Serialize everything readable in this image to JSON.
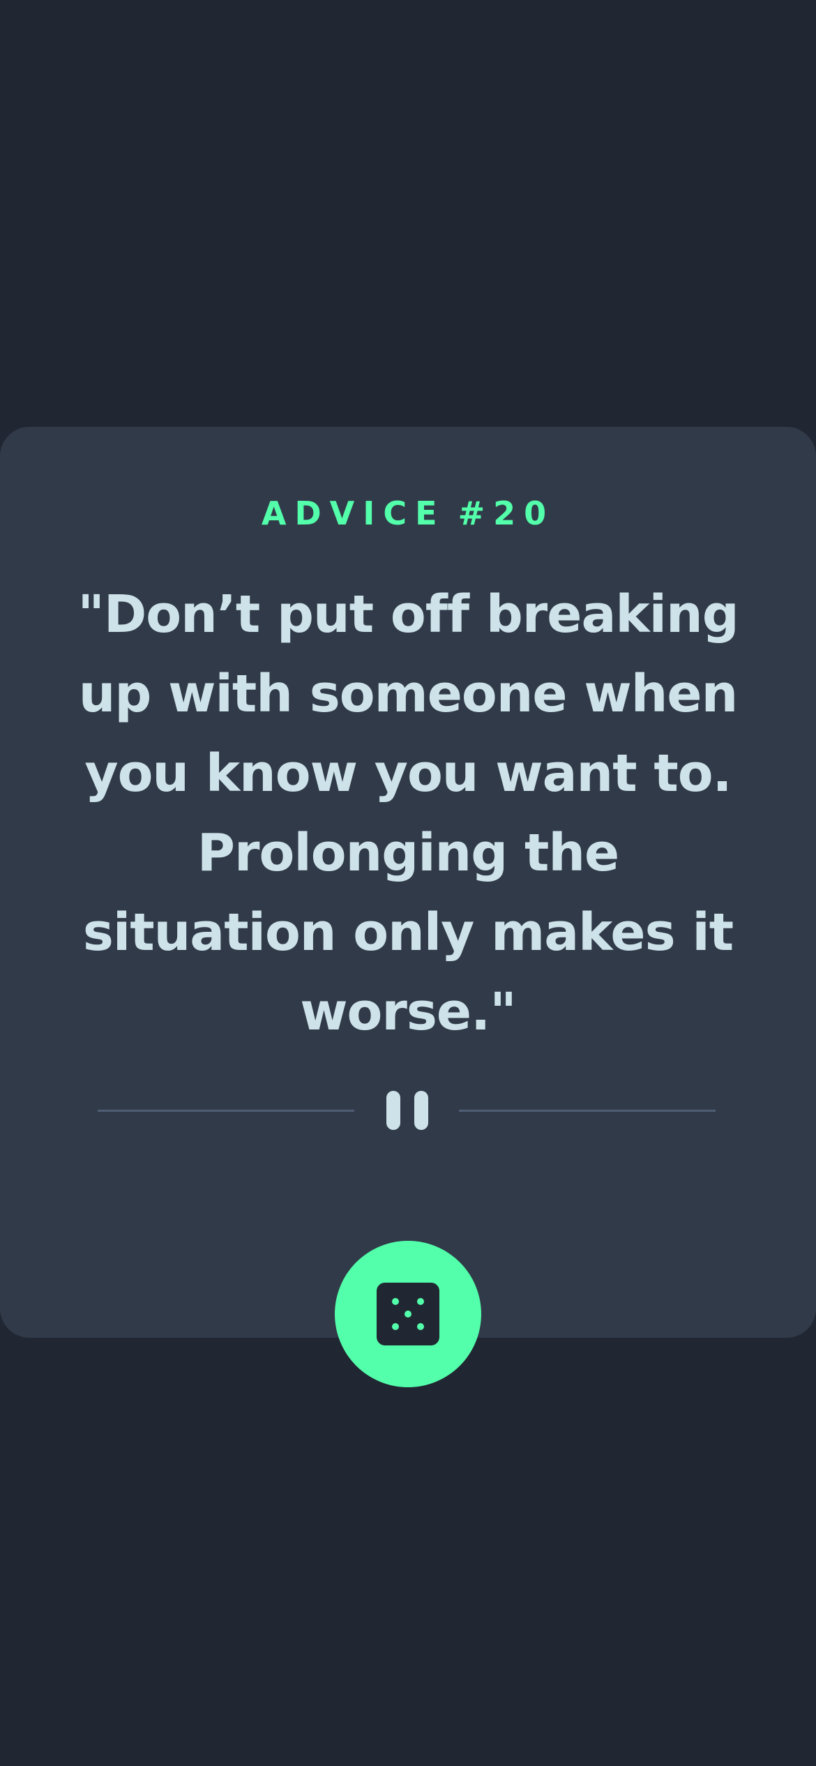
{
  "advice": {
    "label": "ADVICE",
    "number": "#20",
    "quote": "\"Don’t put off breaking up with someone when you know you want to. Prolonging the situation only makes it worse.\""
  },
  "icons": {
    "divider": "pause-icon",
    "button": "dice-icon"
  },
  "colors": {
    "background": "#202632",
    "card": "#313a49",
    "accent": "#53ffaa",
    "text": "#cee3e9",
    "divider_line": "#4f5d74"
  }
}
